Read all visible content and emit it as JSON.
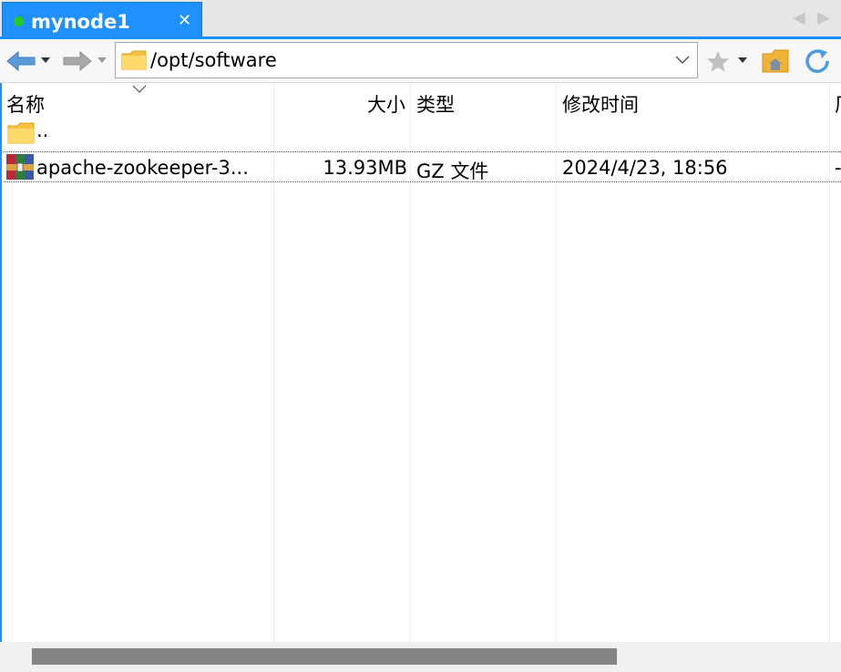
{
  "tab": {
    "title": "mynode1",
    "status_color": "#22cc22",
    "close_glyph": "✕",
    "prev_glyph": "◀",
    "next_glyph": "▶"
  },
  "toolbar": {
    "back_icon": "back-arrow-icon",
    "forward_icon": "forward-arrow-icon",
    "address": "/opt/software",
    "bookmark_icon": "star-icon",
    "home_icon": "home-folder-icon",
    "refresh_icon": "refresh-icon"
  },
  "columns": [
    "名称",
    "大小",
    "类型",
    "修改时间",
    "厂"
  ],
  "rows": [
    {
      "name": "..",
      "size": "",
      "type": "",
      "modified": "",
      "extra": "",
      "icon": "folder-icon"
    },
    {
      "name": "apache-zookeeper-3...",
      "size": "13.93MB",
      "type": "GZ 文件",
      "modified": "2024/4/23, 18:56",
      "extra": "-",
      "icon": "archive-icon"
    }
  ],
  "colors": {
    "accent": "#1e90ff",
    "scroll_thumb": "#858585"
  }
}
